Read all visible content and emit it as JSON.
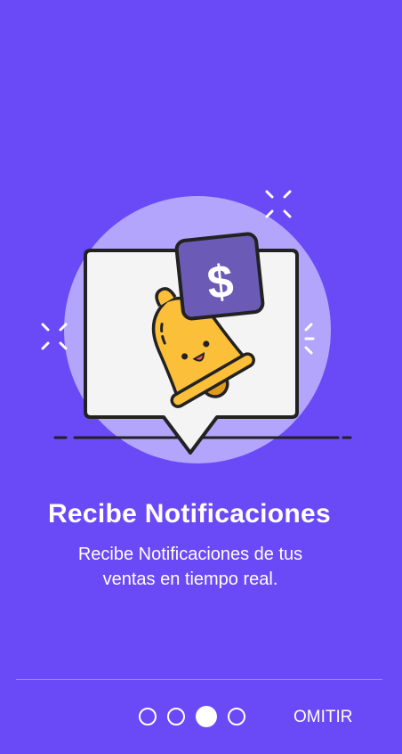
{
  "onboarding": {
    "title": "Recibe Notificaciones",
    "subtitle_line1": "Recibe Notificaciones de tus",
    "subtitle_line2": "ventas en tiempo real.",
    "skip_label": "OMITIR",
    "currency_symbol": "$",
    "current_page": 3,
    "total_pages": 4
  },
  "colors": {
    "background": "#6a4af6",
    "circle": "#b3a5fb",
    "bell": "#fbbf3a",
    "money_tag": "#6b5bb6"
  },
  "icons": {
    "bell": "bell-icon",
    "money": "dollar-icon",
    "chat_bubble": "chat-bubble-icon"
  }
}
